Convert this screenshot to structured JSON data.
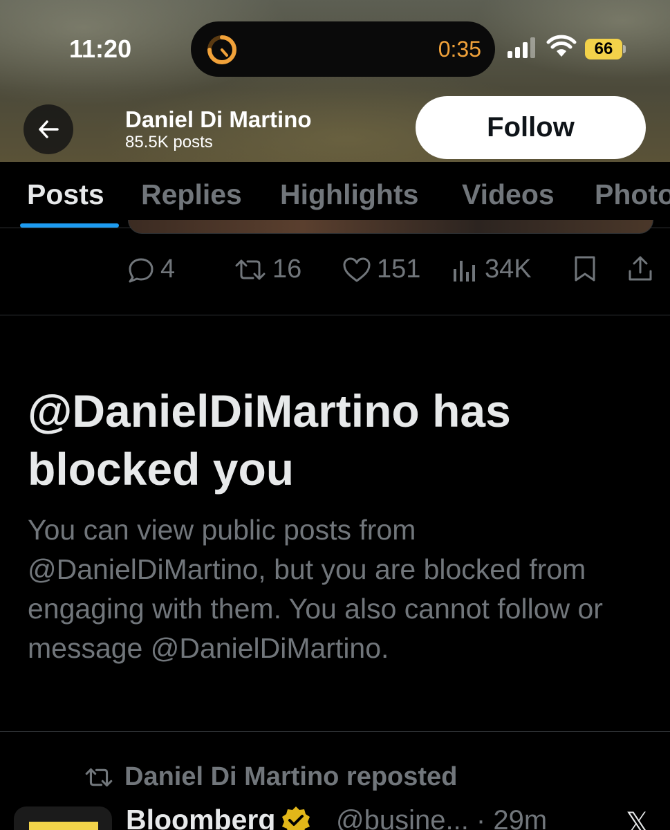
{
  "status_bar": {
    "time": "11:20",
    "timer": "0:35",
    "battery": "66",
    "timer_color": "#f1a23a",
    "battery_color": "#f3d24a"
  },
  "header": {
    "back_icon": "arrow-left-icon",
    "name": "Daniel Di Martino",
    "posts_count": "85.5K posts",
    "follow_label": "Follow"
  },
  "tabs": [
    {
      "label": "Posts",
      "active": true
    },
    {
      "label": "Replies",
      "active": false
    },
    {
      "label": "Highlights",
      "active": false
    },
    {
      "label": "Videos",
      "active": false
    },
    {
      "label": "Photos",
      "active": false
    }
  ],
  "post_actions": {
    "replies": "4",
    "reposts": "16",
    "likes": "151",
    "views": "34K"
  },
  "blocked": {
    "title": "@DanielDiMartino has blocked you",
    "description": "You can view public posts from @DanielDiMartino, but you are blocked from engaging with them. You also cannot follow or message @DanielDiMartino."
  },
  "next_post": {
    "repost_text": "Daniel Di Martino reposted",
    "author_name": "Bloomberg",
    "handle_time": "@busine... · 29m",
    "platform_icon": "x-logo-icon"
  },
  "colors": {
    "accent": "#1d9bf0",
    "muted": "#71767b",
    "verified_gold": "#e2b719"
  }
}
